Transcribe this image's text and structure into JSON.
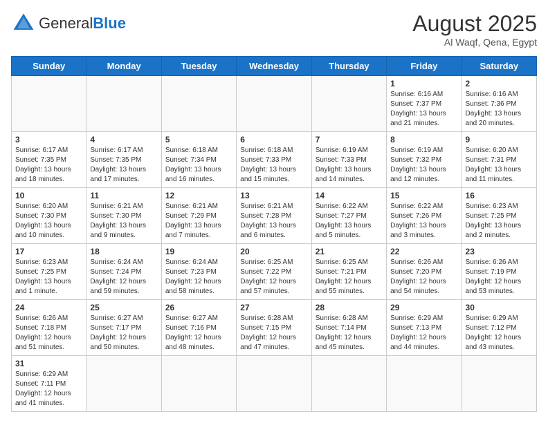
{
  "header": {
    "logo_general": "General",
    "logo_blue": "Blue",
    "month_year": "August 2025",
    "location": "Al Waqf, Qena, Egypt"
  },
  "days_of_week": [
    "Sunday",
    "Monday",
    "Tuesday",
    "Wednesday",
    "Thursday",
    "Friday",
    "Saturday"
  ],
  "weeks": [
    [
      {
        "num": "",
        "info": ""
      },
      {
        "num": "",
        "info": ""
      },
      {
        "num": "",
        "info": ""
      },
      {
        "num": "",
        "info": ""
      },
      {
        "num": "",
        "info": ""
      },
      {
        "num": "1",
        "info": "Sunrise: 6:16 AM\nSunset: 7:37 PM\nDaylight: 13 hours and 21 minutes."
      },
      {
        "num": "2",
        "info": "Sunrise: 6:16 AM\nSunset: 7:36 PM\nDaylight: 13 hours and 20 minutes."
      }
    ],
    [
      {
        "num": "3",
        "info": "Sunrise: 6:17 AM\nSunset: 7:35 PM\nDaylight: 13 hours and 18 minutes."
      },
      {
        "num": "4",
        "info": "Sunrise: 6:17 AM\nSunset: 7:35 PM\nDaylight: 13 hours and 17 minutes."
      },
      {
        "num": "5",
        "info": "Sunrise: 6:18 AM\nSunset: 7:34 PM\nDaylight: 13 hours and 16 minutes."
      },
      {
        "num": "6",
        "info": "Sunrise: 6:18 AM\nSunset: 7:33 PM\nDaylight: 13 hours and 15 minutes."
      },
      {
        "num": "7",
        "info": "Sunrise: 6:19 AM\nSunset: 7:33 PM\nDaylight: 13 hours and 14 minutes."
      },
      {
        "num": "8",
        "info": "Sunrise: 6:19 AM\nSunset: 7:32 PM\nDaylight: 13 hours and 12 minutes."
      },
      {
        "num": "9",
        "info": "Sunrise: 6:20 AM\nSunset: 7:31 PM\nDaylight: 13 hours and 11 minutes."
      }
    ],
    [
      {
        "num": "10",
        "info": "Sunrise: 6:20 AM\nSunset: 7:30 PM\nDaylight: 13 hours and 10 minutes."
      },
      {
        "num": "11",
        "info": "Sunrise: 6:21 AM\nSunset: 7:30 PM\nDaylight: 13 hours and 9 minutes."
      },
      {
        "num": "12",
        "info": "Sunrise: 6:21 AM\nSunset: 7:29 PM\nDaylight: 13 hours and 7 minutes."
      },
      {
        "num": "13",
        "info": "Sunrise: 6:21 AM\nSunset: 7:28 PM\nDaylight: 13 hours and 6 minutes."
      },
      {
        "num": "14",
        "info": "Sunrise: 6:22 AM\nSunset: 7:27 PM\nDaylight: 13 hours and 5 minutes."
      },
      {
        "num": "15",
        "info": "Sunrise: 6:22 AM\nSunset: 7:26 PM\nDaylight: 13 hours and 3 minutes."
      },
      {
        "num": "16",
        "info": "Sunrise: 6:23 AM\nSunset: 7:25 PM\nDaylight: 13 hours and 2 minutes."
      }
    ],
    [
      {
        "num": "17",
        "info": "Sunrise: 6:23 AM\nSunset: 7:25 PM\nDaylight: 13 hours and 1 minute."
      },
      {
        "num": "18",
        "info": "Sunrise: 6:24 AM\nSunset: 7:24 PM\nDaylight: 12 hours and 59 minutes."
      },
      {
        "num": "19",
        "info": "Sunrise: 6:24 AM\nSunset: 7:23 PM\nDaylight: 12 hours and 58 minutes."
      },
      {
        "num": "20",
        "info": "Sunrise: 6:25 AM\nSunset: 7:22 PM\nDaylight: 12 hours and 57 minutes."
      },
      {
        "num": "21",
        "info": "Sunrise: 6:25 AM\nSunset: 7:21 PM\nDaylight: 12 hours and 55 minutes."
      },
      {
        "num": "22",
        "info": "Sunrise: 6:26 AM\nSunset: 7:20 PM\nDaylight: 12 hours and 54 minutes."
      },
      {
        "num": "23",
        "info": "Sunrise: 6:26 AM\nSunset: 7:19 PM\nDaylight: 12 hours and 53 minutes."
      }
    ],
    [
      {
        "num": "24",
        "info": "Sunrise: 6:26 AM\nSunset: 7:18 PM\nDaylight: 12 hours and 51 minutes."
      },
      {
        "num": "25",
        "info": "Sunrise: 6:27 AM\nSunset: 7:17 PM\nDaylight: 12 hours and 50 minutes."
      },
      {
        "num": "26",
        "info": "Sunrise: 6:27 AM\nSunset: 7:16 PM\nDaylight: 12 hours and 48 minutes."
      },
      {
        "num": "27",
        "info": "Sunrise: 6:28 AM\nSunset: 7:15 PM\nDaylight: 12 hours and 47 minutes."
      },
      {
        "num": "28",
        "info": "Sunrise: 6:28 AM\nSunset: 7:14 PM\nDaylight: 12 hours and 45 minutes."
      },
      {
        "num": "29",
        "info": "Sunrise: 6:29 AM\nSunset: 7:13 PM\nDaylight: 12 hours and 44 minutes."
      },
      {
        "num": "30",
        "info": "Sunrise: 6:29 AM\nSunset: 7:12 PM\nDaylight: 12 hours and 43 minutes."
      }
    ],
    [
      {
        "num": "31",
        "info": "Sunrise: 6:29 AM\nSunset: 7:11 PM\nDaylight: 12 hours and 41 minutes."
      },
      {
        "num": "",
        "info": ""
      },
      {
        "num": "",
        "info": ""
      },
      {
        "num": "",
        "info": ""
      },
      {
        "num": "",
        "info": ""
      },
      {
        "num": "",
        "info": ""
      },
      {
        "num": "",
        "info": ""
      }
    ]
  ]
}
